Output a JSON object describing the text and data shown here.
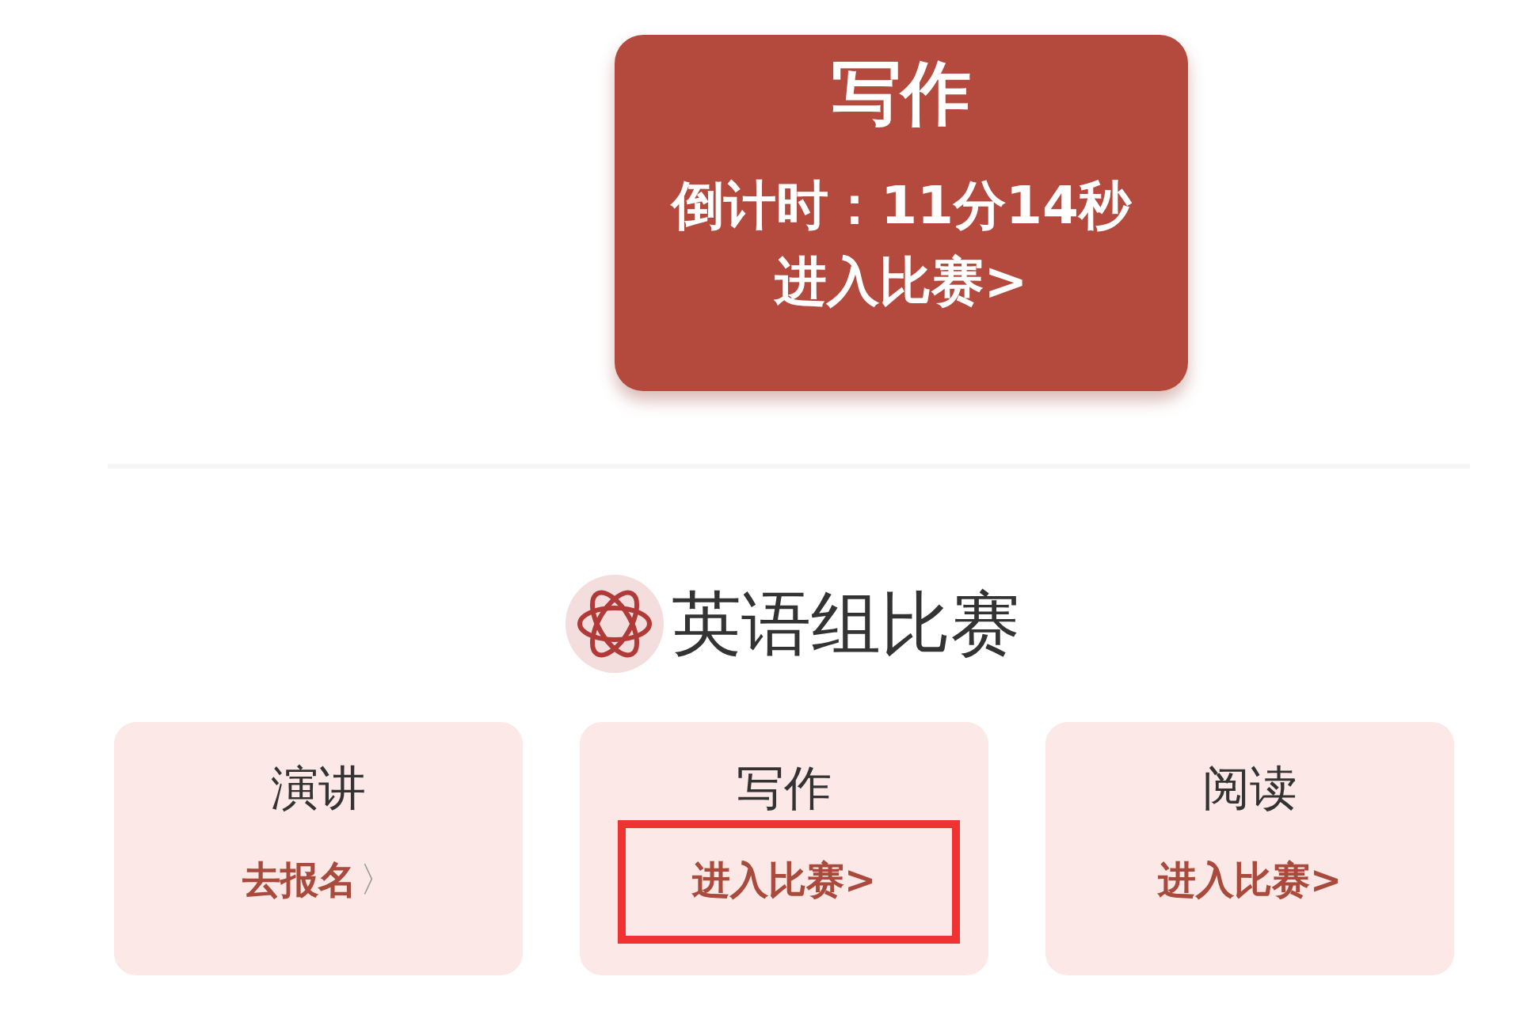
{
  "popup": {
    "title": "写作",
    "countdown": "倒计时：11分14秒",
    "action": "进入比赛>"
  },
  "section": {
    "title": "英语组比赛"
  },
  "cards": [
    {
      "title": "演讲",
      "action": "去报名",
      "arrow": "〉",
      "highlighted": false
    },
    {
      "title": "写作",
      "action": "进入比赛>",
      "highlighted": true
    },
    {
      "title": "阅读",
      "action": "进入比赛>",
      "highlighted": false
    }
  ]
}
